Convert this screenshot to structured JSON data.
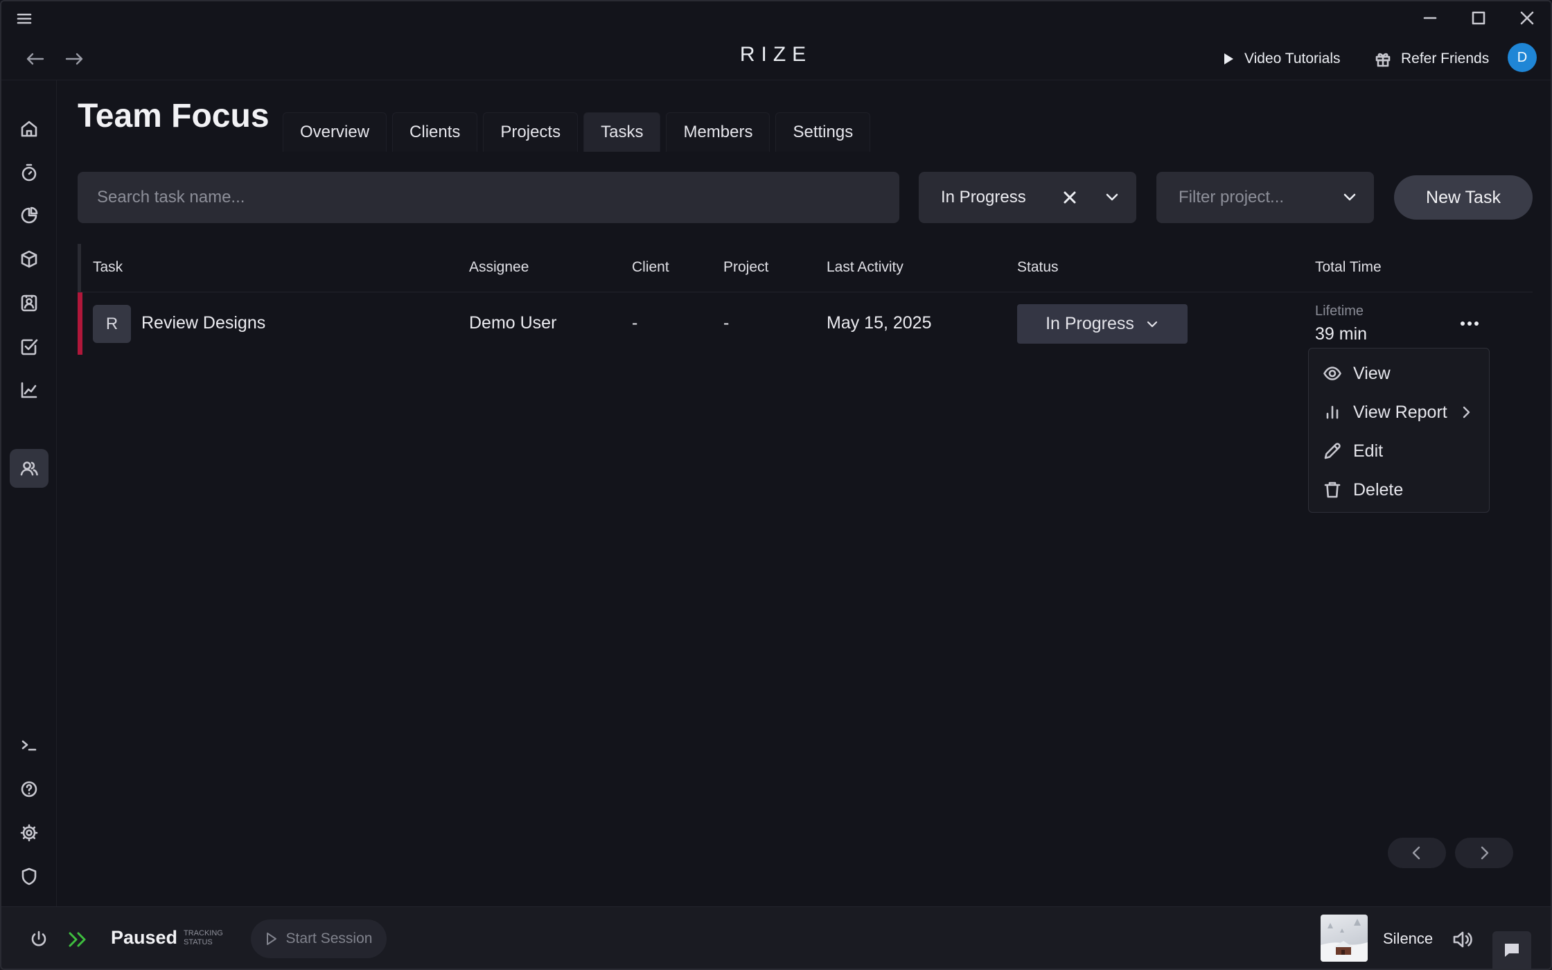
{
  "app": {
    "brand": "RIZE"
  },
  "topbar": {
    "video_tutorials": "Video Tutorials",
    "refer_friends": "Refer Friends",
    "user_initial": "D"
  },
  "page": {
    "title": "Team Focus",
    "tabs": [
      {
        "label": "Overview"
      },
      {
        "label": "Clients"
      },
      {
        "label": "Projects"
      },
      {
        "label": "Tasks",
        "active": true
      },
      {
        "label": "Members"
      },
      {
        "label": "Settings"
      }
    ]
  },
  "filters": {
    "search_placeholder": "Search task name...",
    "status_value": "In Progress",
    "project_placeholder": "Filter project...",
    "new_task": "New Task"
  },
  "table": {
    "columns": [
      "Task",
      "Assignee",
      "Client",
      "Project",
      "Last Activity",
      "Status",
      "Total Time"
    ],
    "rows": [
      {
        "initial": "R",
        "task": "Review Designs",
        "assignee": "Demo User",
        "client": "-",
        "project": "-",
        "last_activity": "May 15, 2025",
        "status": "In Progress",
        "time_label": "Lifetime",
        "time_value": "39 min"
      }
    ]
  },
  "context_menu": {
    "items": [
      {
        "label": "View",
        "icon": "eye-icon"
      },
      {
        "label": "View Report",
        "icon": "bar-chart-icon"
      },
      {
        "label": "Edit",
        "icon": "pencil-icon"
      },
      {
        "label": "Delete",
        "icon": "trash-icon"
      }
    ]
  },
  "bottombar": {
    "status": "Paused",
    "tracking_label_1": "TRACKING",
    "tracking_label_2": "STATUS",
    "start_session": "Start Session",
    "music_title": "Silence"
  },
  "colors": {
    "background": "#13141b",
    "row_accent": "#b0173a",
    "avatar_blue": "#1f86d6",
    "tracking_green": "#3fbf3f"
  }
}
